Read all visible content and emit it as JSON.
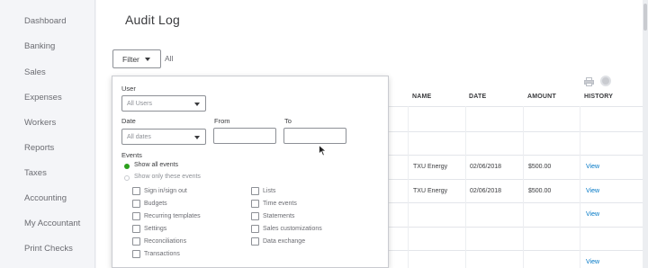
{
  "sidebar": {
    "items": [
      {
        "label": "Dashboard"
      },
      {
        "label": "Banking"
      },
      {
        "label": "Sales"
      },
      {
        "label": "Expenses"
      },
      {
        "label": "Workers"
      },
      {
        "label": "Reports"
      },
      {
        "label": "Taxes"
      },
      {
        "label": "Accounting"
      },
      {
        "label": "My Accountant"
      },
      {
        "label": "Print Checks"
      }
    ]
  },
  "page": {
    "title": "Audit Log",
    "filter_label": "Filter",
    "filter_summary": "All"
  },
  "table": {
    "headers": [
      "NAME",
      "DATE",
      "AMOUNT",
      "HISTORY"
    ],
    "rows": [
      {
        "name": "TXU Energy",
        "date": "02/06/2018",
        "amount": "$500.00",
        "history": "View"
      },
      {
        "name": "TXU Energy",
        "date": "02/06/2018",
        "amount": "$500.00",
        "history": "View"
      },
      {
        "history": "View"
      },
      {
        "history": "View"
      }
    ]
  },
  "filter_panel": {
    "user_label": "User",
    "user_value": "All Users",
    "date_label": "Date",
    "date_value": "All dates",
    "from_label": "From",
    "to_label": "To",
    "events_label": "Events",
    "radio_all": "Show all events",
    "radio_some": "Show only these events",
    "events_left": [
      "Sign in/sign out",
      "Budgets",
      "Recurring templates",
      "Settings",
      "Reconciliations",
      "Transactions"
    ],
    "events_right": [
      "Lists",
      "Time events",
      "Statements",
      "Sales customizations",
      "Data exchange"
    ]
  },
  "colors": {
    "accent_green": "#2ca01c",
    "link_blue": "#0077c5"
  }
}
